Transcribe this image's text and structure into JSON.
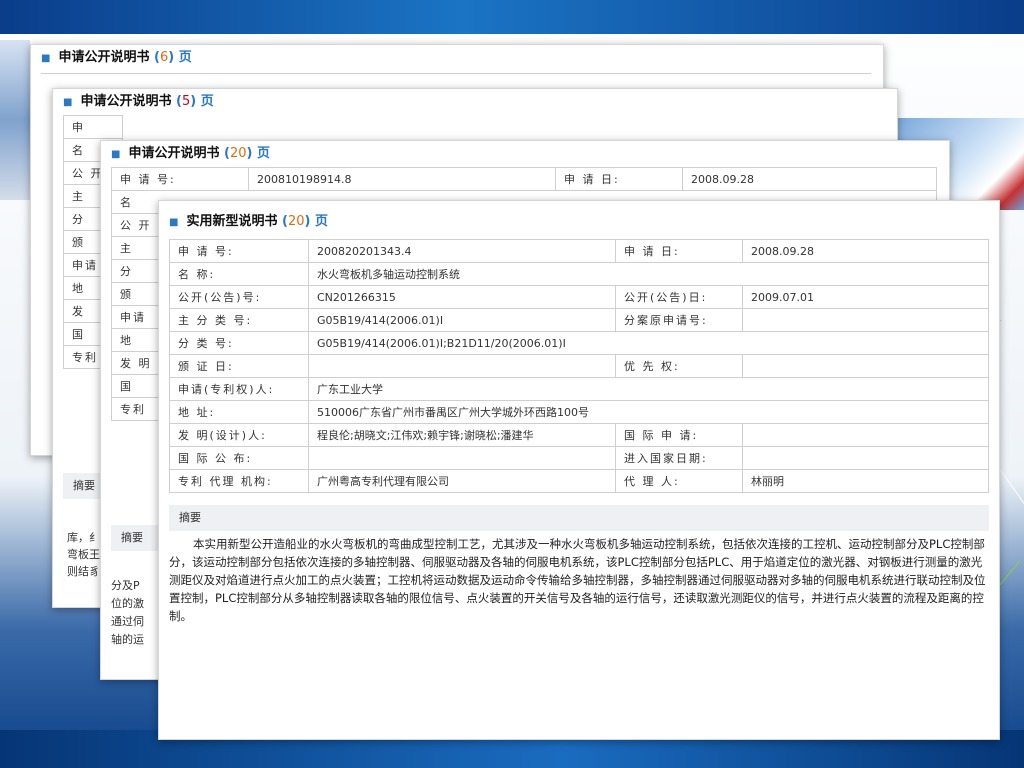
{
  "cards": {
    "c1": {
      "title": "申请公开说明书",
      "page_num": "6",
      "page_suffix": "页",
      "rows": [
        "申 请 号:",
        "申 请 日:"
      ]
    },
    "c2": {
      "title": "申请公开说明书",
      "page_num": "5",
      "page_suffix": "页",
      "labels": [
        "申",
        "名",
        "公 开",
        "主",
        "分",
        "颁",
        "申请",
        "地",
        "发",
        "国",
        "专利"
      ],
      "abstract_label": "摘要",
      "fragments": [
        "库，纟",
        "弯板王",
        "则结豸"
      ]
    },
    "c3": {
      "title": "申请公开说明书",
      "page_num": "20",
      "page_suffix": "页",
      "app_no_label": "申 请 号:",
      "app_no": "200810198914.8",
      "app_date_label": "申 请 日:",
      "app_date": "2008.09.28",
      "labels": [
        "名",
        "公 开",
        "主",
        "分",
        "颁",
        "申请",
        "地",
        "发 明",
        "国",
        "专利"
      ],
      "abstract_label": "摘要",
      "fragments": [
        "分及P",
        "位的激",
        "通过伺",
        "轴的运"
      ]
    },
    "c4": {
      "title": "实用新型说明书",
      "page_num": "20",
      "page_suffix": "页",
      "rows": [
        {
          "l1": "申 请 号:",
          "v1": "200820201343.4",
          "l2": "申 请 日:",
          "v2": "2008.09.28"
        },
        {
          "l1": "名 称:",
          "v1": "水火弯板机多轴运动控制系统"
        },
        {
          "l1": "公开(公告)号:",
          "v1": "CN201266315",
          "l2": "公开(公告)日:",
          "v2": "2009.07.01"
        },
        {
          "l1": "主 分 类 号:",
          "v1": "G05B19/414(2006.01)I",
          "l2": "分案原申请号:",
          "v2": ""
        },
        {
          "l1": "分 类 号:",
          "v1": "G05B19/414(2006.01)I;B21D11/20(2006.01)I"
        },
        {
          "l1": "颁 证 日:",
          "v1": "",
          "l2": "优 先 权:",
          "v2": ""
        },
        {
          "l1": "申请(专利权)人:",
          "v1": "广东工业大学"
        },
        {
          "l1": "地 址:",
          "v1": "510006广东省广州市番禺区广州大学城外环西路100号"
        },
        {
          "l1": "发 明(设计)人:",
          "v1": "程良伦;胡晓文;江伟欢;赖宇锋;谢晓松;潘建华",
          "l2": "国 际 申 请:",
          "v2": ""
        },
        {
          "l1": "国 际 公 布:",
          "v1": "",
          "l2": "进入国家日期:",
          "v2": ""
        },
        {
          "l1": "专利 代理 机构:",
          "v1": "广州粤高专利代理有限公司",
          "l2": "代 理 人:",
          "v2": "林丽明"
        }
      ],
      "abstract_label": "摘要",
      "abstract": "本实用新型公开造船业的水火弯板机的弯曲成型控制工艺，尤其涉及一种水火弯板机多轴运动控制系统，包括依次连接的工控机、运动控制部分及PLC控制部分，该运动控制部分包括依次连接的多轴控制器、伺服驱动器及各轴的伺服电机系统，该PLC控制部分包括PLC、用于焰道定位的激光器、对钢板进行测量的激光测距仪及对焰道进行点火加工的点火装置；工控机将运动数据及运动命令传输给多轴控制器，多轴控制器通过伺服驱动器对多轴的伺服电机系统进行联动控制及位置控制，PLC控制部分从多轴控制器读取各轴的限位信号、点火装置的开关信号及各轴的运行信号，还读取激光测距仪的信号，并进行点火装置的流程及距离的控制。"
    }
  }
}
